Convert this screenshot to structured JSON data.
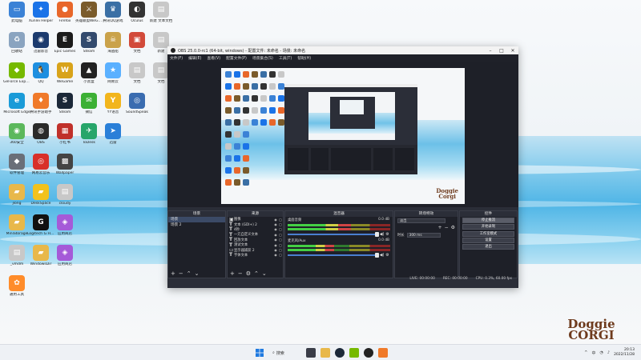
{
  "desktop": {
    "icons": [
      {
        "label": "此电脑",
        "color": "#3b82d6",
        "glyph": "▭",
        "col": 0,
        "row": 0
      },
      {
        "label": "Xunlei Helper",
        "color": "#1a73e8",
        "glyph": "✦",
        "col": 1,
        "row": 0
      },
      {
        "label": "Firefox",
        "color": "#e8672a",
        "glyph": "●",
        "col": 2,
        "row": 0
      },
      {
        "label": "英雄联盟WeGame",
        "color": "#7a5b2b",
        "glyph": "⚔",
        "col": 3,
        "row": 0
      },
      {
        "label": "腾讯QQ游戏",
        "color": "#3a6fa5",
        "glyph": "♛",
        "col": 4,
        "row": 0
      },
      {
        "label": "Oculus",
        "color": "#333333",
        "glyph": "◐",
        "col": 5,
        "row": 0
      },
      {
        "label": "新建 文本文档",
        "color": "#c8c8c8",
        "glyph": "▤",
        "col": 6,
        "row": 0
      },
      {
        "label": "回收站",
        "color": "#8aa4c0",
        "glyph": "♻",
        "col": 0,
        "row": 1
      },
      {
        "label": "迅雷影音",
        "color": "#1c3b6e",
        "glyph": "◉",
        "col": 1,
        "row": 1
      },
      {
        "label": "Epic Games",
        "color": "#1b1b1b",
        "glyph": "E",
        "col": 2,
        "row": 1
      },
      {
        "label": "Steam",
        "color": "#334b6e",
        "glyph": "S",
        "col": 3,
        "row": 1
      },
      {
        "label": "海盗船",
        "color": "#caa24a",
        "glyph": "☠",
        "col": 4,
        "row": 1
      },
      {
        "label": "文档",
        "color": "#d24a3a",
        "glyph": "▣",
        "col": 5,
        "row": 1
      },
      {
        "label": "新建",
        "color": "#c8c8c8",
        "glyph": "▤",
        "col": 6,
        "row": 1
      },
      {
        "label": "GeForce Experience",
        "color": "#76b900",
        "glyph": "◆",
        "col": 0,
        "row": 2
      },
      {
        "label": "QQ",
        "color": "#1e8fe0",
        "glyph": "🐧",
        "col": 1,
        "row": 2
      },
      {
        "label": "WeGame",
        "color": "#d8a31a",
        "glyph": "W",
        "col": 2,
        "row": 2
      },
      {
        "label": "小黑盒",
        "color": "#222222",
        "glyph": "▲",
        "col": 3,
        "row": 2
      },
      {
        "label": "网易云",
        "color": "#5ab0ff",
        "glyph": "★",
        "col": 4,
        "row": 2
      },
      {
        "label": "文档",
        "color": "#c8c8c8",
        "glyph": "▤",
        "col": 5,
        "row": 2
      },
      {
        "label": "文档",
        "color": "#c8c8c8",
        "glyph": "▤",
        "col": 6,
        "row": 2
      },
      {
        "label": "Microsoft Edge",
        "color": "#1a9bd8",
        "glyph": "e",
        "col": 0,
        "row": 3
      },
      {
        "label": "腾讯手游助手",
        "color": "#f07a2a",
        "glyph": "♦",
        "col": 1,
        "row": 3
      },
      {
        "label": "Steam",
        "color": "#1b2838",
        "glyph": "S",
        "col": 2,
        "row": 3
      },
      {
        "label": "微信",
        "color": "#3cb034",
        "glyph": "✉",
        "col": 3,
        "row": 3
      },
      {
        "label": "YY语音",
        "color": "#f2b51c",
        "glyph": "Y",
        "col": 4,
        "row": 3
      },
      {
        "label": "SoundSpeak",
        "color": "#3a6cb0",
        "glyph": "◎",
        "col": 5,
        "row": 3
      },
      {
        "label": "360安全",
        "color": "#5cb85c",
        "glyph": "◉",
        "col": 0,
        "row": 4
      },
      {
        "label": "OBS",
        "color": "#2a2a2a",
        "glyph": "◍",
        "col": 1,
        "row": 4
      },
      {
        "label": "小红书",
        "color": "#c0302a",
        "glyph": "▦",
        "col": 2,
        "row": 4
      },
      {
        "label": "ToDesk",
        "color": "#27a56a",
        "glyph": "✈",
        "col": 3,
        "row": 4
      },
      {
        "label": "迅雷",
        "color": "#2a7fd8",
        "glyph": "➤",
        "col": 4,
        "row": 4
      },
      {
        "label": "软件管理",
        "color": "#6a6f78",
        "glyph": "◆",
        "col": 0,
        "row": 5
      },
      {
        "label": "网易云音乐",
        "color": "#d8302a",
        "glyph": "◎",
        "col": 1,
        "row": 5
      },
      {
        "label": "Wallpaper",
        "color": "#444444",
        "glyph": "▩",
        "col": 2,
        "row": 5
      },
      {
        "label": "jlong",
        "color": "#e8b84a",
        "glyph": "▰",
        "col": 0,
        "row": 6
      },
      {
        "label": "DeskSpace",
        "color": "#f2c21c",
        "glyph": "▰",
        "col": 1,
        "row": 6
      },
      {
        "label": "cloudy",
        "color": "#c8c8c8",
        "glyph": "▤",
        "col": 2,
        "row": 6
      },
      {
        "label": "MiniStorage",
        "color": "#e8b84a",
        "glyph": "▰",
        "col": 0,
        "row": 7
      },
      {
        "label": "Logitech G HUB",
        "color": "#111111",
        "glyph": "G",
        "col": 1,
        "row": 7
      },
      {
        "label": "应用商店",
        "color": "#a55ad8",
        "glyph": "◈",
        "col": 2,
        "row": 7
      },
      {
        "label": "_vmdm",
        "color": "#c8c8c8",
        "glyph": "▤",
        "col": 0,
        "row": 8
      },
      {
        "label": "WindowsDir",
        "color": "#e8b84a",
        "glyph": "▰",
        "col": 1,
        "row": 8
      },
      {
        "label": "应用商店",
        "color": "#a55ad8",
        "glyph": "◈",
        "col": 2,
        "row": 8
      },
      {
        "label": "通用工具",
        "color": "#ff8c2a",
        "glyph": "✿",
        "col": 0,
        "row": 9
      }
    ]
  },
  "wallpaper": {
    "logo_line1": "Doggie",
    "logo_line2": "CORGI"
  },
  "obs": {
    "title": "OBS 25.0.0-rc1 (64-bit, windows) - 配置文件: 未命名 - 场景: 未命名",
    "menu": [
      "文件(F)",
      "编辑(E)",
      "查看(V)",
      "配置文件(P)",
      "场景集合(S)",
      "工具(T)",
      "帮助(H)"
    ],
    "canvas_logo1": "Doggie",
    "canvas_logo2": "Corgi",
    "docks": {
      "scenes": {
        "title": "场景",
        "items": [
          "场景",
          "场景 2"
        ]
      },
      "sources": {
        "title": "来源",
        "items": [
          {
            "icon": "▣",
            "name": "图像"
          },
          {
            "icon": "T",
            "name": "文本 (GDI+) 2"
          },
          {
            "icon": "T",
            "name": "4秒"
          },
          {
            "icon": "T",
            "name": "一元自定义文本"
          },
          {
            "icon": "T",
            "name": "回放文本"
          },
          {
            "icon": "T",
            "name": "测试文本"
          },
          {
            "icon": "▭",
            "name": "显示器捕获 2"
          },
          {
            "icon": "T",
            "name": "字体文本"
          }
        ]
      },
      "mixer": {
        "title": "混音器",
        "channels": [
          {
            "name": "桌面音频",
            "db": "0.0 dB",
            "level": 0.62,
            "volume": 1.0
          },
          {
            "name": "麦克风/Aux",
            "db": "0.0 dB",
            "level": 0.45,
            "volume": 1.0
          }
        ]
      },
      "transitions": {
        "title": "转场特效",
        "selected": "淡出",
        "duration_label": "时长",
        "duration_value": "300 ms"
      },
      "controls": {
        "title": "控件",
        "buttons": [
          "停止推流",
          "开始录制",
          "工作室模式",
          "设置",
          "退出"
        ],
        "active_index": 0
      }
    },
    "status": [
      "LIVE: 00:00:00",
      "REC: 00:00:00",
      "CPU: 0.3%, 60.00 fps"
    ]
  },
  "taskbar": {
    "search_label": "搜索",
    "tray_arrow": "^",
    "tray_lang": "中",
    "time": "20:13",
    "date": "2022/11/28"
  }
}
